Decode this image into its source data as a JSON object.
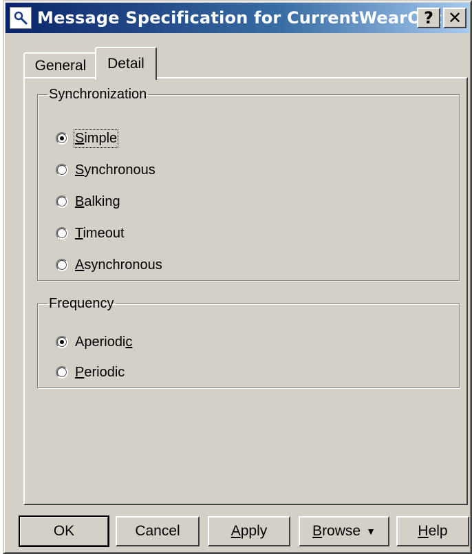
{
  "window": {
    "title": "Message Specification for CurrentWearOut()",
    "help_glyph": "?",
    "close_glyph": "✕"
  },
  "tabs": [
    {
      "label": "General",
      "active": false
    },
    {
      "label": "Detail",
      "active": true
    }
  ],
  "synchronization": {
    "label": "Synchronization",
    "options": [
      {
        "pre": "",
        "key": "S",
        "post": "imple",
        "checked": true
      },
      {
        "pre": "",
        "key": "S",
        "post": "ynchronous",
        "checked": false
      },
      {
        "pre": "",
        "key": "B",
        "post": "alking",
        "checked": false
      },
      {
        "pre": "",
        "key": "T",
        "post": "imeout",
        "checked": false
      },
      {
        "pre": "",
        "key": "A",
        "post": "synchronous",
        "checked": false
      }
    ]
  },
  "frequency": {
    "label": "Frequency",
    "options": [
      {
        "pre": "Aperiodi",
        "key": "c",
        "post": "",
        "checked": true
      },
      {
        "pre": "",
        "key": "P",
        "post": "eriodic",
        "checked": false
      }
    ]
  },
  "buttons": {
    "ok": {
      "pre": "OK",
      "key": "",
      "post": ""
    },
    "cancel": {
      "pre": "Cancel",
      "key": "",
      "post": ""
    },
    "apply": {
      "pre": "",
      "key": "A",
      "post": "pply"
    },
    "browse": {
      "pre": "",
      "key": "B",
      "post": "rowse"
    },
    "help": {
      "pre": "",
      "key": "H",
      "post": "elp"
    }
  },
  "icons": {
    "title": "search-icon",
    "browse_caret": "caret-down-icon"
  }
}
